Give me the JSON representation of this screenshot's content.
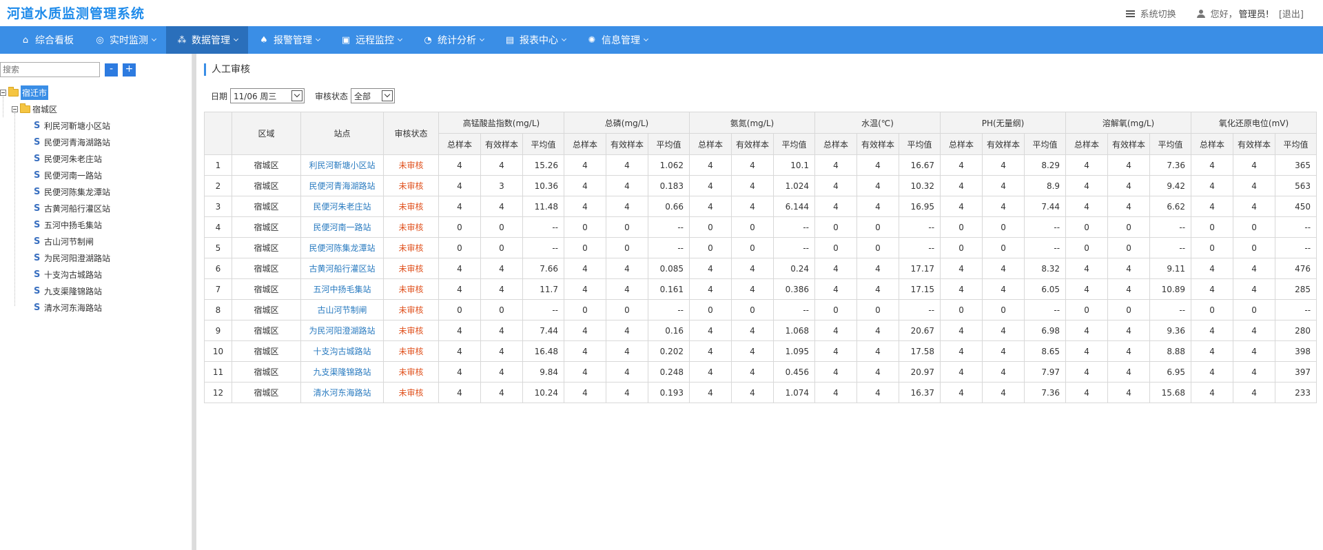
{
  "app": {
    "title": "河道水质监测管理系统",
    "switch_label": "系统切换",
    "greeting": "您好，",
    "admin": "管理员!",
    "logout": "[退出]"
  },
  "nav": [
    {
      "label": "综合看板",
      "icon": "home-icon",
      "glyph": "⌂",
      "caret": false,
      "active": false
    },
    {
      "label": "实时监测",
      "icon": "globe-icon",
      "glyph": "◎",
      "caret": true,
      "active": false
    },
    {
      "label": "数据管理",
      "icon": "share-icon",
      "glyph": "⁂",
      "caret": true,
      "active": true
    },
    {
      "label": "报警管理",
      "icon": "bell-icon",
      "glyph": "♠",
      "caret": true,
      "active": false
    },
    {
      "label": "远程监控",
      "icon": "monitor-icon",
      "glyph": "▣",
      "caret": true,
      "active": false
    },
    {
      "label": "统计分析",
      "icon": "pie-chart-icon",
      "glyph": "◔",
      "caret": true,
      "active": false
    },
    {
      "label": "报表中心",
      "icon": "report-icon",
      "glyph": "▤",
      "caret": true,
      "active": false
    },
    {
      "label": "信息管理",
      "icon": "gear-icon",
      "glyph": "✺",
      "caret": true,
      "active": false
    }
  ],
  "sidebar": {
    "search_placeholder": "搜索",
    "minus": "-",
    "plus": "+",
    "root": "宿迁市",
    "district": "宿城区",
    "stations": [
      "利民河靳塘小区站",
      "民便河青海湖路站",
      "民便河朱老庄站",
      "民便河南一路站",
      "民便河陈集龙潭站",
      "古黄河船行灌区站",
      "五河中扬毛集站",
      "古山河节制闸",
      "为民河阳澄湖路站",
      "十支沟古城路站",
      "九支渠隆锦路站",
      "清水河东海路站"
    ]
  },
  "page": {
    "title": "人工审核",
    "date_label": "日期",
    "date_value": "11/06 周三",
    "status_label": "审核状态",
    "status_value": "全部"
  },
  "table": {
    "cols": {
      "region": "区域",
      "station": "站点",
      "status": "审核状态"
    },
    "groups": [
      "高锰酸盐指数(mg/L)",
      "总磷(mg/L)",
      "氨氮(mg/L)",
      "水温(℃)",
      "PH(无量纲)",
      "溶解氧(mg/L)",
      "氧化还原电位(mV)"
    ],
    "sub": [
      "总样本",
      "有效样本",
      "平均值"
    ],
    "rows": [
      {
        "no": "1",
        "region": "宿城区",
        "station": "利民河靳塘小区站",
        "status": "未审核",
        "vals": [
          "4",
          "4",
          "15.26",
          "4",
          "4",
          "1.062",
          "4",
          "4",
          "10.1",
          "4",
          "4",
          "16.67",
          "4",
          "4",
          "8.29",
          "4",
          "4",
          "7.36",
          "4",
          "4",
          "365"
        ]
      },
      {
        "no": "2",
        "region": "宿城区",
        "station": "民便河青海湖路站",
        "status": "未审核",
        "vals": [
          "4",
          "3",
          "10.36",
          "4",
          "4",
          "0.183",
          "4",
          "4",
          "1.024",
          "4",
          "4",
          "10.32",
          "4",
          "4",
          "8.9",
          "4",
          "4",
          "9.42",
          "4",
          "4",
          "563"
        ]
      },
      {
        "no": "3",
        "region": "宿城区",
        "station": "民便河朱老庄站",
        "status": "未审核",
        "vals": [
          "4",
          "4",
          "11.48",
          "4",
          "4",
          "0.66",
          "4",
          "4",
          "6.144",
          "4",
          "4",
          "16.95",
          "4",
          "4",
          "7.44",
          "4",
          "4",
          "6.62",
          "4",
          "4",
          "450"
        ]
      },
      {
        "no": "4",
        "region": "宿城区",
        "station": "民便河南一路站",
        "status": "未审核",
        "vals": [
          "0",
          "0",
          "--",
          "0",
          "0",
          "--",
          "0",
          "0",
          "--",
          "0",
          "0",
          "--",
          "0",
          "0",
          "--",
          "0",
          "0",
          "--",
          "0",
          "0",
          "--"
        ]
      },
      {
        "no": "5",
        "region": "宿城区",
        "station": "民便河陈集龙潭站",
        "status": "未审核",
        "vals": [
          "0",
          "0",
          "--",
          "0",
          "0",
          "--",
          "0",
          "0",
          "--",
          "0",
          "0",
          "--",
          "0",
          "0",
          "--",
          "0",
          "0",
          "--",
          "0",
          "0",
          "--"
        ]
      },
      {
        "no": "6",
        "region": "宿城区",
        "station": "古黄河船行灌区站",
        "status": "未审核",
        "vals": [
          "4",
          "4",
          "7.66",
          "4",
          "4",
          "0.085",
          "4",
          "4",
          "0.24",
          "4",
          "4",
          "17.17",
          "4",
          "4",
          "8.32",
          "4",
          "4",
          "9.11",
          "4",
          "4",
          "476"
        ]
      },
      {
        "no": "7",
        "region": "宿城区",
        "station": "五河中扬毛集站",
        "status": "未审核",
        "vals": [
          "4",
          "4",
          "11.7",
          "4",
          "4",
          "0.161",
          "4",
          "4",
          "0.386",
          "4",
          "4",
          "17.15",
          "4",
          "4",
          "6.05",
          "4",
          "4",
          "10.89",
          "4",
          "4",
          "285"
        ]
      },
      {
        "no": "8",
        "region": "宿城区",
        "station": "古山河节制闸",
        "status": "未审核",
        "vals": [
          "0",
          "0",
          "--",
          "0",
          "0",
          "--",
          "0",
          "0",
          "--",
          "0",
          "0",
          "--",
          "0",
          "0",
          "--",
          "0",
          "0",
          "--",
          "0",
          "0",
          "--"
        ]
      },
      {
        "no": "9",
        "region": "宿城区",
        "station": "为民河阳澄湖路站",
        "status": "未审核",
        "vals": [
          "4",
          "4",
          "7.44",
          "4",
          "4",
          "0.16",
          "4",
          "4",
          "1.068",
          "4",
          "4",
          "20.67",
          "4",
          "4",
          "6.98",
          "4",
          "4",
          "9.36",
          "4",
          "4",
          "280"
        ]
      },
      {
        "no": "10",
        "region": "宿城区",
        "station": "十支沟古城路站",
        "status": "未审核",
        "vals": [
          "4",
          "4",
          "16.48",
          "4",
          "4",
          "0.202",
          "4",
          "4",
          "1.095",
          "4",
          "4",
          "17.58",
          "4",
          "4",
          "8.65",
          "4",
          "4",
          "8.88",
          "4",
          "4",
          "398"
        ]
      },
      {
        "no": "11",
        "region": "宿城区",
        "station": "九支渠隆锦路站",
        "status": "未审核",
        "vals": [
          "4",
          "4",
          "9.84",
          "4",
          "4",
          "0.248",
          "4",
          "4",
          "0.456",
          "4",
          "4",
          "20.97",
          "4",
          "4",
          "7.97",
          "4",
          "4",
          "6.95",
          "4",
          "4",
          "397"
        ]
      },
      {
        "no": "12",
        "region": "宿城区",
        "station": "清水河东海路站",
        "status": "未审核",
        "vals": [
          "4",
          "4",
          "10.24",
          "4",
          "4",
          "0.193",
          "4",
          "4",
          "1.074",
          "4",
          "4",
          "16.37",
          "4",
          "4",
          "7.36",
          "4",
          "4",
          "15.68",
          "4",
          "4",
          "233"
        ]
      }
    ]
  },
  "colors": {
    "accent": "#3a8ee6",
    "nav_active": "#2a6fbb",
    "link": "#2a7bc0",
    "status": "#e0521f",
    "title": "#1f8bea"
  }
}
